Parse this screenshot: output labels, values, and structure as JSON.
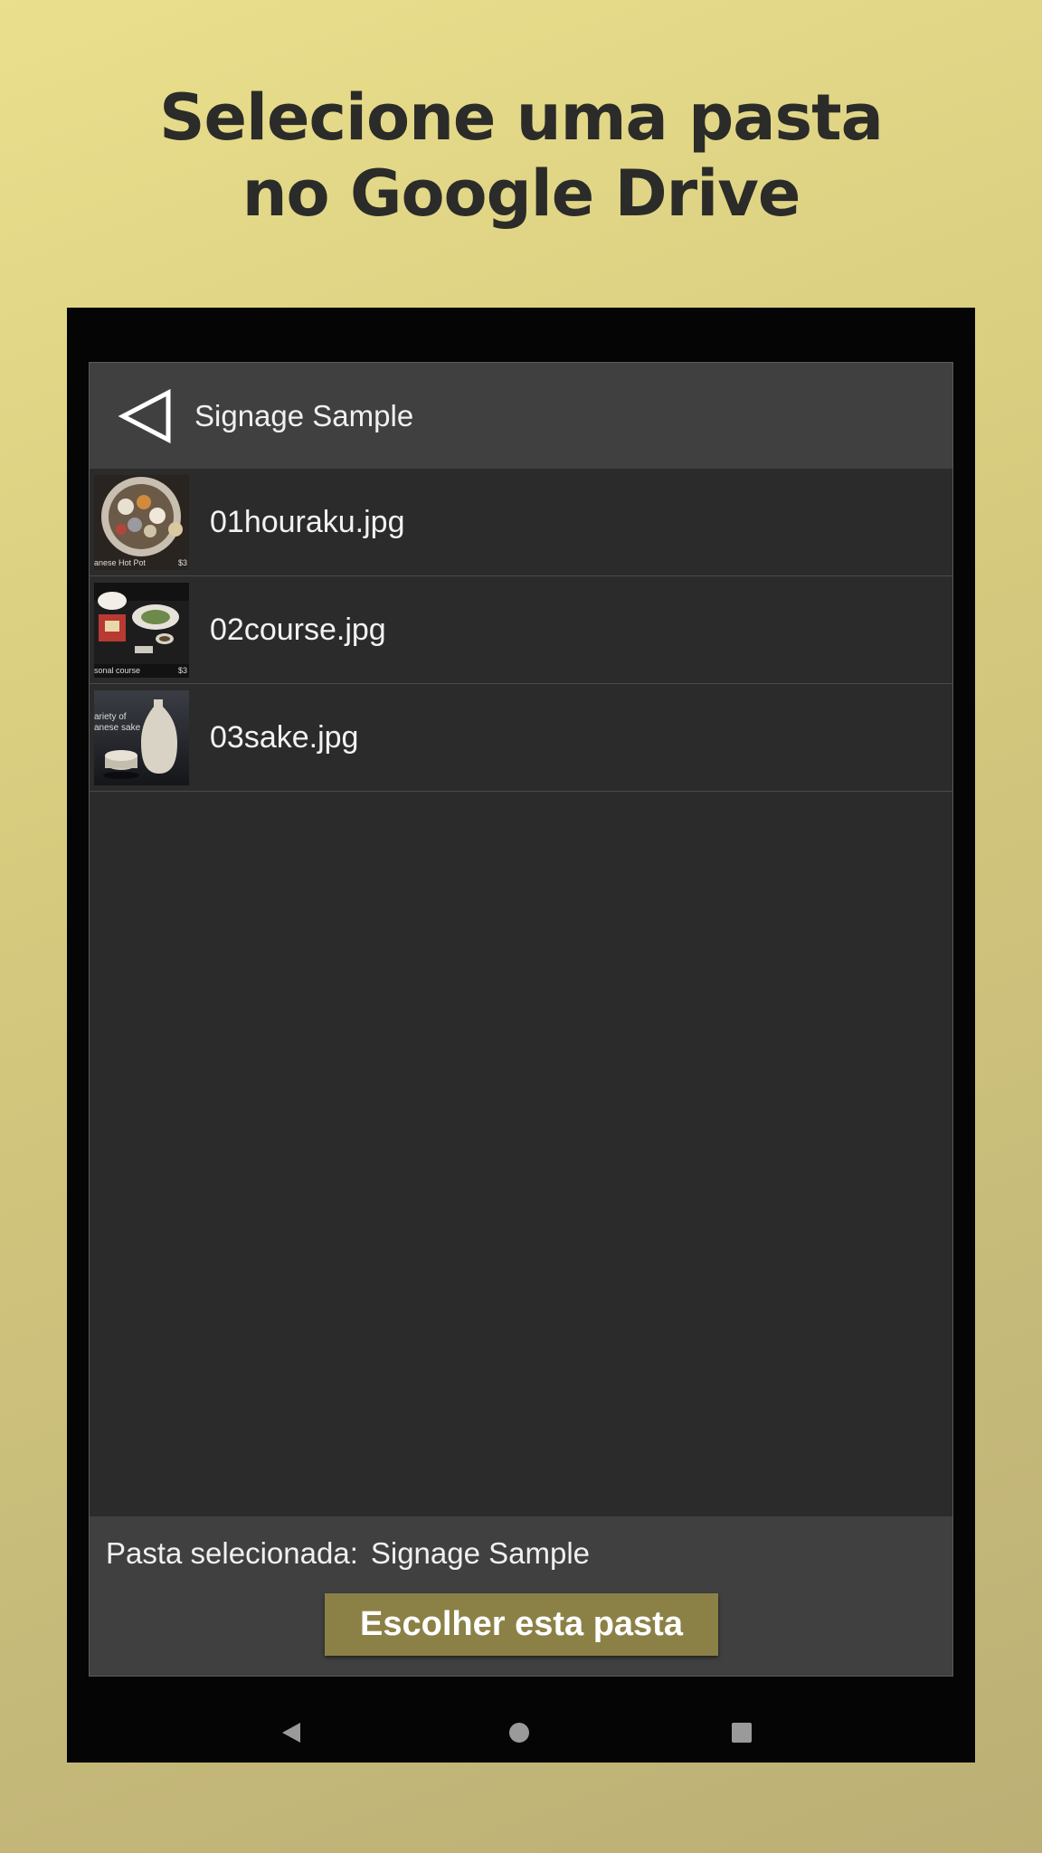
{
  "promo": {
    "headline_line1": "Selecione uma pasta",
    "headline_line2": "no Google Drive"
  },
  "header": {
    "back_icon": "back-triangle-icon",
    "title": "Signage Sample"
  },
  "files": [
    {
      "name": "01houraku.jpg",
      "thumb_caption_left": "anese Hot Pot",
      "thumb_caption_right": "$3"
    },
    {
      "name": "02course.jpg",
      "thumb_caption_left": "sonal course",
      "thumb_caption_right": "$3"
    },
    {
      "name": "03sake.jpg",
      "thumb_caption_top": "ariety of\nanese sake"
    }
  ],
  "footer": {
    "selected_label": "Pasta selecionada:",
    "selected_value": "Signage Sample",
    "choose_button": "Escolher esta pasta"
  },
  "navbar": {
    "back": "nav-back-icon",
    "home": "nav-home-icon",
    "recents": "nav-recents-icon"
  },
  "colors": {
    "accent_button": "#8b8147",
    "header_bg": "#404040",
    "list_bg": "#2b2b2b"
  }
}
